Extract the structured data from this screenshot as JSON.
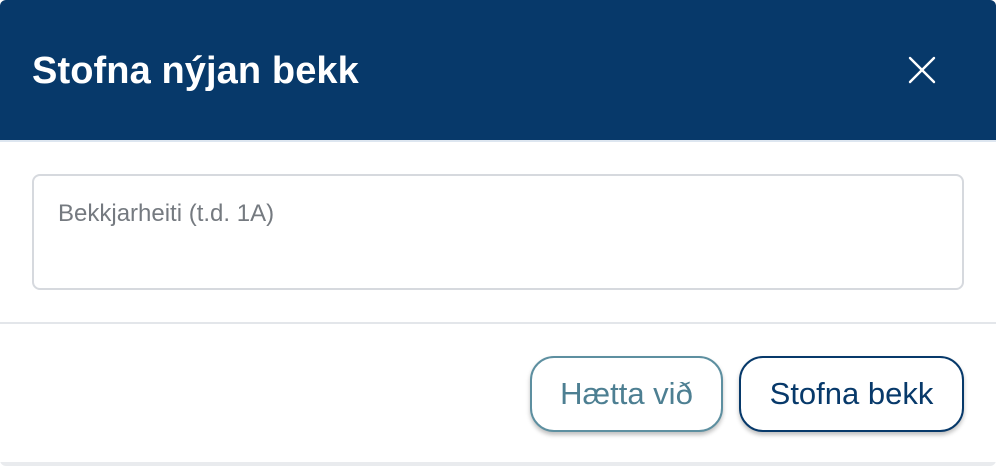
{
  "modal": {
    "title": "Stofna nýjan bekk",
    "close_icon": "close-icon"
  },
  "form": {
    "class_name": {
      "placeholder": "Bekkjarheiti (t.d. 1A)",
      "value": ""
    }
  },
  "footer": {
    "cancel_label": "Hætta við",
    "create_label": "Stofna bekk"
  },
  "colors": {
    "header_bg": "#07396a",
    "primary": "#07396a",
    "secondary": "#4d7f92"
  }
}
